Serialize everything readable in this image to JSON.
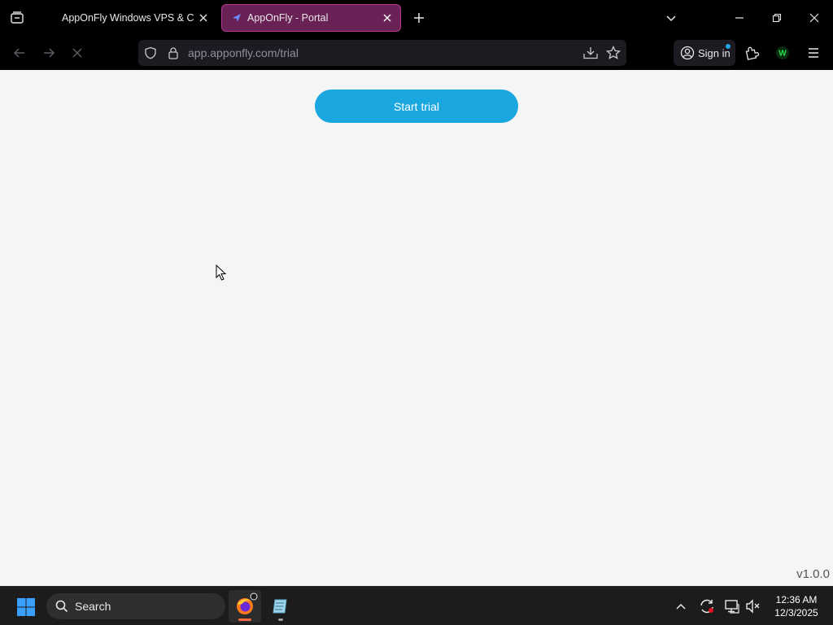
{
  "browser": {
    "tabs": [
      {
        "title": "AppOnFly Windows VPS & Cloud",
        "active": false
      },
      {
        "title": "AppOnFly - Portal",
        "active": true
      }
    ],
    "url": "app.apponfly.com/trial",
    "signin_label": "Sign in",
    "extension_label": "W"
  },
  "icons": {
    "tab_list": "tab-list-icon",
    "close": "close-icon",
    "new_tab": "plus-icon",
    "dropdown": "chevron-down-icon",
    "back": "back-arrow-icon",
    "forward": "forward-arrow-icon",
    "stop": "stop-icon",
    "shield": "shield-icon",
    "lock": "lock-icon",
    "download": "download-icon",
    "bookmark": "star-icon",
    "account": "account-icon",
    "extensions": "puzzle-icon",
    "menu": "hamburger-icon"
  },
  "page": {
    "start_trial_label": "Start trial",
    "version": "v1.0.0"
  },
  "taskbar": {
    "search_label": "Search",
    "time": "12:36 AM",
    "date": "12/3/2025"
  },
  "colors": {
    "accent_button": "#1aa7e0",
    "active_tab": "#6a2256",
    "active_tab_border": "#b23a92",
    "page_background": "#f5f5f5",
    "taskbar": "#1c1c1c",
    "windows_logo": "#3aa0ff"
  }
}
